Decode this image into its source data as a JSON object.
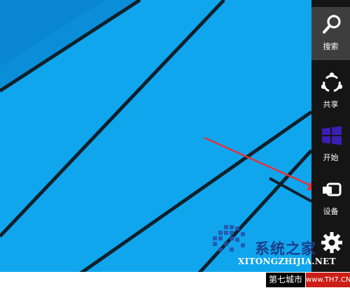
{
  "charms": [
    {
      "label": "搜索",
      "icon": "search-icon",
      "active": true
    },
    {
      "label": "共享",
      "icon": "share-icon",
      "active": false
    },
    {
      "label": "开始",
      "icon": "windows-logo-icon",
      "active": false
    },
    {
      "label": "设备",
      "icon": "devices-icon",
      "active": false
    },
    {
      "label": "",
      "icon": "settings-gear-icon",
      "active": false
    }
  ],
  "watermark": {
    "title": "系统之家",
    "subtitle": "XITONGZHIJIA.NET"
  },
  "footer": {
    "left": "第七城市",
    "right": "www.TH7.CN"
  },
  "colors": {
    "desktop_background": "#0fa6ee",
    "charms_bar": "#151515",
    "arrow": "#e0343c",
    "windows_logo": "#3a1fb5"
  }
}
